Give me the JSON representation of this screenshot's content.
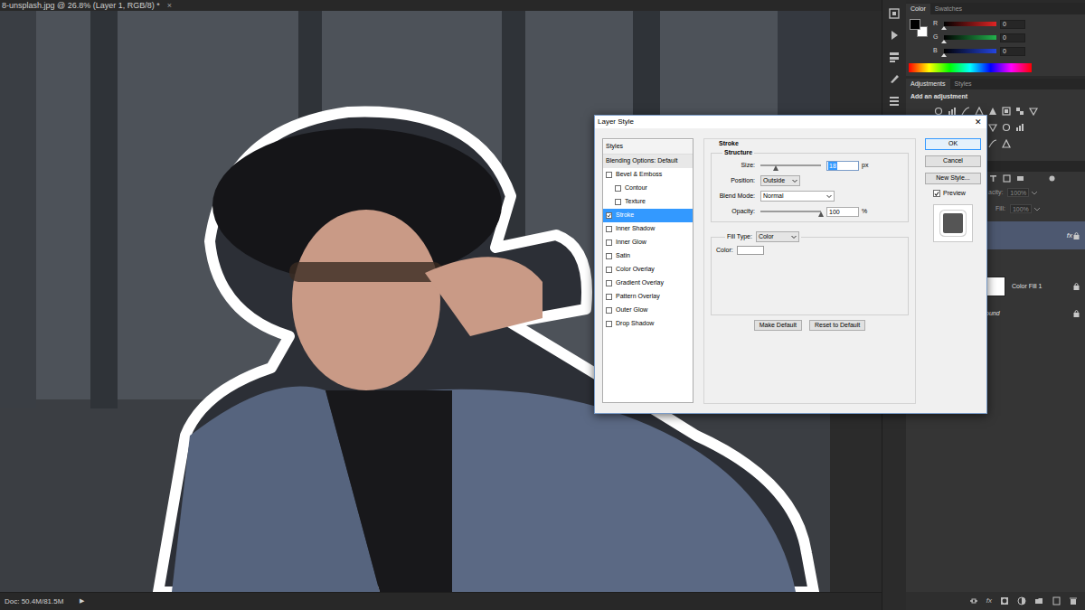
{
  "document": {
    "title": "8-unsplash.jpg @ 26.8% (Layer 1, RGB/8) *",
    "close": "×",
    "status": "Doc: 50.4M/81.5M",
    "status_arrow": "▶"
  },
  "color_panel": {
    "tabs": [
      {
        "label": "Color",
        "selected": true
      },
      {
        "label": "Swatches",
        "selected": false
      }
    ],
    "channels": [
      {
        "name": "R",
        "value": "0",
        "level": 0,
        "color": "#e02424"
      },
      {
        "name": "G",
        "value": "0",
        "level": 0,
        "color": "#22b14c"
      },
      {
        "name": "B",
        "value": "0",
        "level": 0,
        "color": "#2445e0"
      }
    ]
  },
  "adjustments_panel": {
    "tabs": [
      {
        "label": "Adjustments",
        "selected": true
      },
      {
        "label": "Styles",
        "selected": false
      }
    ],
    "hint": "Add an adjustment"
  },
  "layers_panel": {
    "opacity_label": "acity:",
    "opacity": "100%",
    "fill_label": "Fill:",
    "fill": "100%",
    "layers": [
      {
        "kind": "effects",
        "fx": "fx",
        "selected": true,
        "locked": false
      },
      {
        "kind": "fill",
        "name": "Color Fill 1",
        "selected": false,
        "locked": false
      },
      {
        "kind": "background",
        "name": "ound",
        "selected": false,
        "locked": true
      }
    ],
    "footer_fx": "fx"
  },
  "dialog": {
    "title": "Layer Style",
    "close": "✕",
    "styles_header": "Styles",
    "styles": [
      {
        "label": "Blending Options: Default",
        "kind": "header",
        "selected": false
      },
      {
        "label": "Bevel & Emboss",
        "kind": "checkbox",
        "checked": false,
        "selected": false
      },
      {
        "label": "Contour",
        "kind": "sub",
        "checked": false,
        "selected": false
      },
      {
        "label": "Texture",
        "kind": "sub",
        "checked": false,
        "selected": false
      },
      {
        "label": "Stroke",
        "kind": "checkbox",
        "checked": true,
        "selected": true
      },
      {
        "label": "Inner Shadow",
        "kind": "checkbox",
        "checked": false,
        "selected": false
      },
      {
        "label": "Inner Glow",
        "kind": "checkbox",
        "checked": false,
        "selected": false
      },
      {
        "label": "Satin",
        "kind": "checkbox",
        "checked": false,
        "selected": false
      },
      {
        "label": "Color Overlay",
        "kind": "checkbox",
        "checked": false,
        "selected": false
      },
      {
        "label": "Gradient Overlay",
        "kind": "checkbox",
        "checked": false,
        "selected": false
      },
      {
        "label": "Pattern Overlay",
        "kind": "checkbox",
        "checked": false,
        "selected": false
      },
      {
        "label": "Outer Glow",
        "kind": "checkbox",
        "checked": false,
        "selected": false
      },
      {
        "label": "Drop Shadow",
        "kind": "checkbox",
        "checked": false,
        "selected": false
      }
    ],
    "section_title": "Stroke",
    "structure_title": "Structure",
    "size": {
      "label": "Size:",
      "value": "18",
      "unit": "px",
      "level": 0.25
    },
    "position": {
      "label": "Position:",
      "value": "Outside"
    },
    "blend_mode": {
      "label": "Blend Mode:",
      "value": "Normal"
    },
    "opacity": {
      "label": "Opacity:",
      "value": "100",
      "unit": "%",
      "level": 1
    },
    "fill_type": {
      "label": "Fill Type:",
      "value": "Color"
    },
    "color": {
      "label": "Color:",
      "swatch": "#ffffff"
    },
    "lower_buttons": [
      "Make Default",
      "Reset to Default"
    ],
    "buttons": [
      {
        "label": "OK",
        "default": true
      },
      {
        "label": "Cancel",
        "default": false
      },
      {
        "label": "New Style...",
        "default": false
      }
    ],
    "preview": {
      "label": "Preview",
      "checked": true
    }
  }
}
